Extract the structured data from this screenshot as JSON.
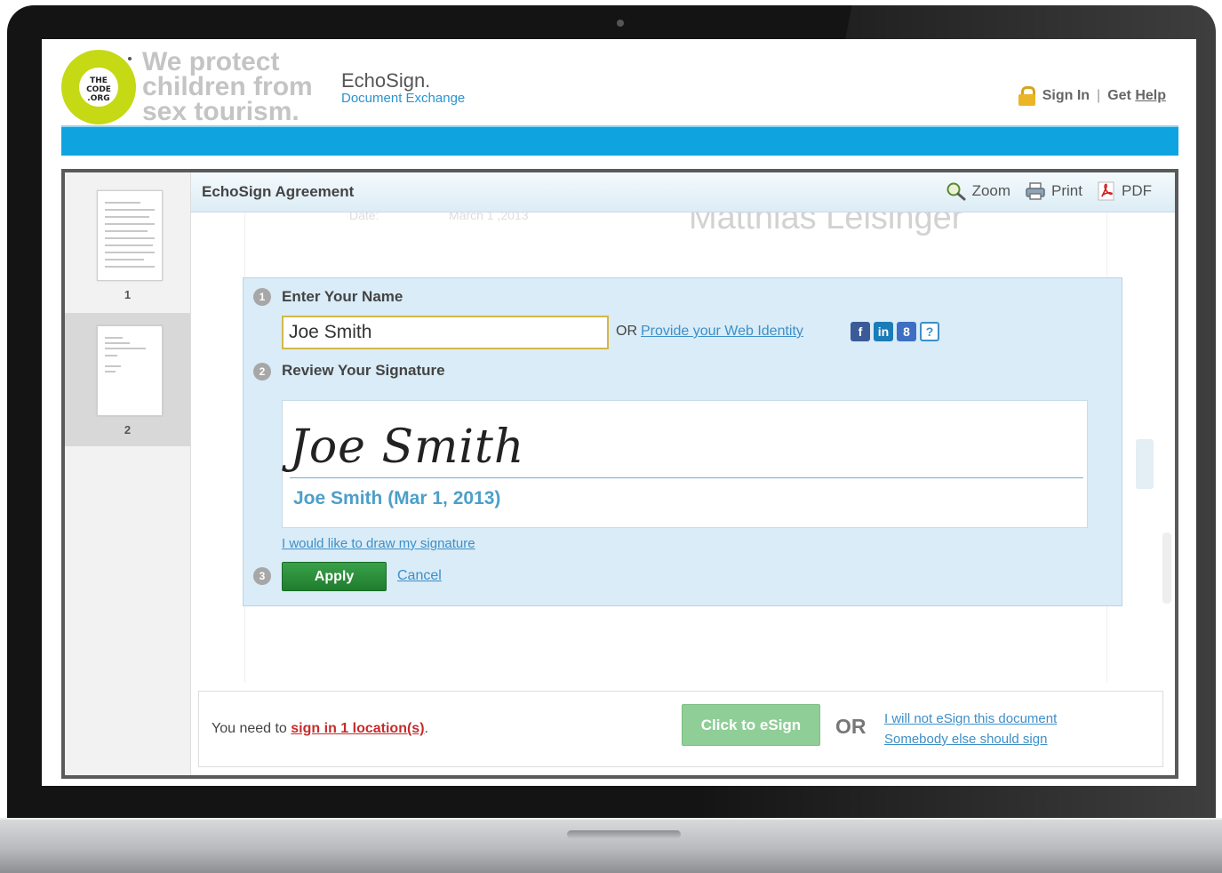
{
  "header": {
    "logo_text": "THE CODE .ORG",
    "tagline": "We protect children from sex tourism.",
    "brand": "EchoSign.",
    "brand_sub": "Document Exchange",
    "sign_in": "Sign In",
    "separator": "|",
    "get_help_prefix": "Get ",
    "get_help_link": "Help"
  },
  "thumbnails": [
    {
      "label": "1",
      "active": false
    },
    {
      "label": "2",
      "active": true
    }
  ],
  "toolbar": {
    "title": "EchoSign Agreement",
    "zoom": "Zoom",
    "print": "Print",
    "pdf": "PDF"
  },
  "document_background": {
    "date_label": "Date:",
    "date_value": "March 1 ,2013",
    "signer_name": "Matthias Leisinger"
  },
  "sign_panel": {
    "step1": {
      "number": "1",
      "label": "Enter Your Name"
    },
    "name_value": "Joe Smith",
    "or": "OR",
    "web_identity_link": "Provide your Web Identity",
    "social": {
      "facebook": "f",
      "linkedin": "in",
      "google": "8",
      "help": "?"
    },
    "step2": {
      "number": "2",
      "label": "Review Your Signature"
    },
    "signature_script": "Joe Smith",
    "signature_caption": "Joe Smith (Mar 1, 2013)",
    "draw_link": "I would like to draw my signature",
    "step3": {
      "number": "3"
    },
    "apply": "Apply",
    "cancel": "Cancel"
  },
  "bottom": {
    "need_prefix": "You need to ",
    "need_link": "sign in 1 location(s)",
    "need_suffix": ".",
    "esign_button": "Click to eSign",
    "or": "OR",
    "decline_link": "I will not eSign this document",
    "delegate_link": "Somebody else should sign"
  },
  "colors": {
    "accent_blue": "#0fa4e0",
    "logo_green": "#c5d915",
    "apply_green": "#2a8f3b",
    "link_blue": "#3d8fc7",
    "alert_red": "#c62c2c"
  }
}
